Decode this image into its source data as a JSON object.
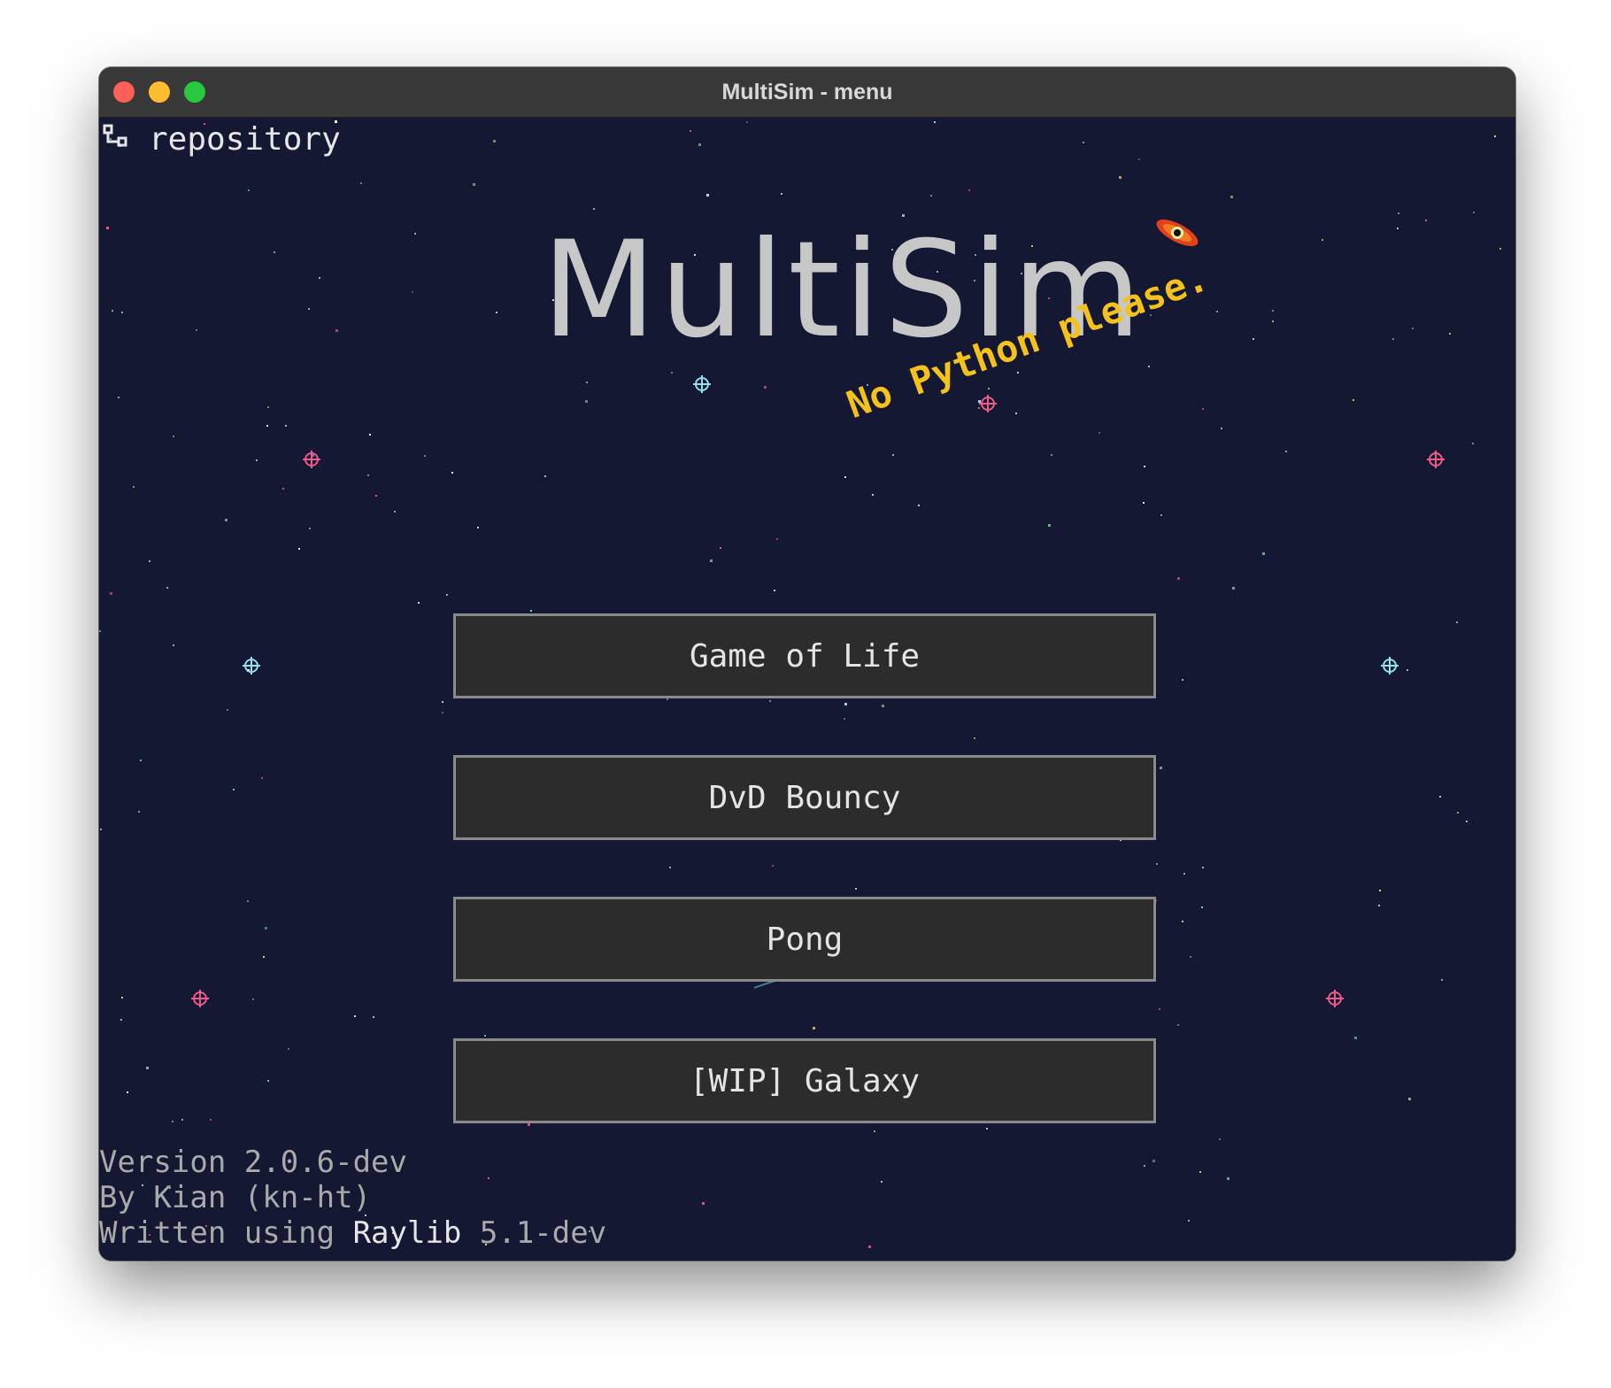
{
  "window": {
    "title": "MultiSim - menu"
  },
  "header": {
    "repository_label": "repository"
  },
  "logo": {
    "title": "MultiSim",
    "tagline": "No Python please."
  },
  "menu": {
    "buttons": [
      {
        "label": "Game of Life"
      },
      {
        "label": "DvD Bouncy"
      },
      {
        "label": "Pong"
      },
      {
        "label": "[WIP] Galaxy"
      }
    ]
  },
  "footer": {
    "version": "Version 2.0.6-dev",
    "author": "By Kian (kn-ht)",
    "written_prefix": "Written using ",
    "library": "Raylib",
    "library_version": " 5.1-dev"
  },
  "icons": {
    "repository": "git-branch-icon",
    "decoration": "black-hole-icon"
  },
  "colors": {
    "background": "#141833",
    "titlebar": "#383838",
    "button_fill": "#2c2c2c",
    "button_border": "#8a8a8a",
    "logo_text": "#c7c7c7",
    "tagline": "#f4c21a",
    "traffic_close": "#fe5f57",
    "traffic_minimize": "#febc2e",
    "traffic_maximize": "#28c840"
  }
}
